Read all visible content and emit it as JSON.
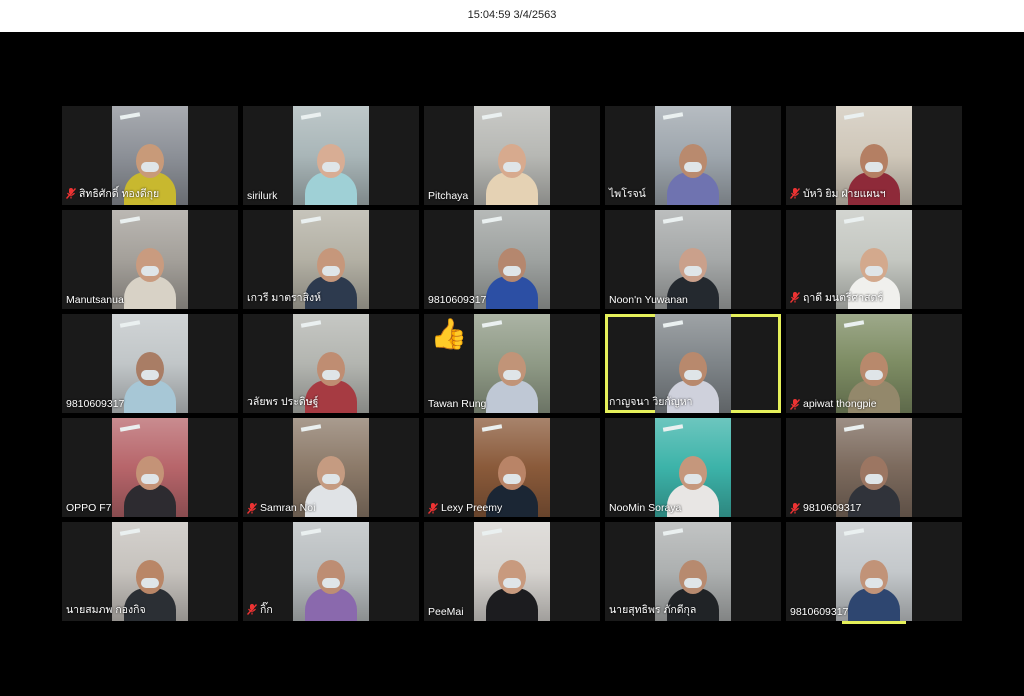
{
  "titlebar": {
    "clock": "15:04:59 3/4/2563"
  },
  "tiles": [
    {
      "name": "สิทธิศักดิ์ ทองดีกุย",
      "muted": true,
      "bg": "#8c9097",
      "face": "#c89a79",
      "shirt": "#c8b82f"
    },
    {
      "name": "sirilurk",
      "muted": false,
      "bg": "#a9b6b8",
      "face": "#d8ad94",
      "shirt": "#9fd0d6"
    },
    {
      "name": "Pitchaya",
      "muted": false,
      "bg": "#b7b8b4",
      "face": "#d7aa8e",
      "shirt": "#e5d2b4"
    },
    {
      "name": "ไพโรจน์",
      "muted": false,
      "bg": "#9ea6ad",
      "face": "#b98a6e",
      "shirt": "#6f73b0"
    },
    {
      "name": "บัหวิ ยิม ฝ่ายแผนฯ",
      "muted": true,
      "bg": "#cfc7b9",
      "face": "#b47f63",
      "shirt": "#8e2a39"
    },
    {
      "name": "Manutsanua",
      "muted": false,
      "bg": "#a4a09a",
      "face": "#c99b7f",
      "shirt": "#d8d2c6"
    },
    {
      "name": "เกวรี มาตราสิงห์",
      "muted": false,
      "bg": "#b3b0a4",
      "face": "#c6977b",
      "shirt": "#2d3a4e"
    },
    {
      "name": "9810609317",
      "muted": false,
      "bg": "#9ea2a0",
      "face": "#b5876e",
      "shirt": "#2c4fa4"
    },
    {
      "name": "Noon'n Yuwanan",
      "muted": false,
      "bg": "#a5a8a8",
      "face": "#caa08b",
      "shirt": "#24292f"
    },
    {
      "name": "ฤาดี มนตรีศาสตร์",
      "muted": true,
      "bg": "#c4c7c1",
      "face": "#d3a98d",
      "shirt": "#f0f0ed"
    },
    {
      "name": "9810609317",
      "muted": false,
      "bg": "#c1c6c8",
      "face": "#a97d65",
      "shirt": "#a7c7d6"
    },
    {
      "name": "วลัยพร ประดิษฐ์",
      "muted": false,
      "bg": "#b3b5b0",
      "face": "#bf8d72",
      "shirt": "#a63b42"
    },
    {
      "name": "Tawan Rung",
      "muted": false,
      "bg": "#8f9a86",
      "face": "#c19478",
      "shirt": "#bfc8d5",
      "thumb": "👍"
    },
    {
      "name": "กาญจนา วิยกัญหา",
      "muted": false,
      "bg": "#7e8488",
      "face": "#b8896d",
      "shirt": "#cfd1dc"
    },
    {
      "name": "apiwat thongpie",
      "muted": true,
      "bg": "#7d8c63",
      "face": "#b8896c",
      "shirt": "#93886b"
    },
    {
      "name": "OPPO F7",
      "muted": false,
      "bg": "#b7656a",
      "face": "#c49377",
      "shirt": "#2d2b30"
    },
    {
      "name": "Samran Noi",
      "muted": true,
      "bg": "#8c7a69",
      "face": "#c59b81",
      "shirt": "#e0e3e6"
    },
    {
      "name": "Lexy Preemy",
      "muted": true,
      "bg": "#8a5a3a",
      "face": "#b98467",
      "shirt": "#1b2634"
    },
    {
      "name": "NooMin Soraya",
      "muted": false,
      "bg": "#3cb3a9",
      "face": "#c5977c",
      "shirt": "#e8e6e4"
    },
    {
      "name": "9810609317",
      "muted": true,
      "bg": "#7c6a5d",
      "face": "#9c7662",
      "shirt": "#30333a"
    },
    {
      "name": "นายสมภพ กองกิจ",
      "muted": false,
      "bg": "#c6c2bd",
      "face": "#b98667",
      "shirt": "#2b2f34"
    },
    {
      "name": "กิ๊ก",
      "muted": true,
      "bg": "#b9bec0",
      "face": "#bd8d73",
      "shirt": "#8a69ad"
    },
    {
      "name": "PeeMai",
      "muted": false,
      "bg": "#d6d3cf",
      "face": "#c89a7e",
      "shirt": "#1c1c1f"
    },
    {
      "name": "นายสุทธิพร ภักดีกุล",
      "muted": false,
      "bg": "#adb0b0",
      "face": "#b78a6f",
      "shirt": "#202326"
    },
    {
      "name": "9810609317",
      "muted": false,
      "bg": "#c4c8cb",
      "face": "#c19378",
      "shirt": "#2e4670"
    }
  ],
  "active_tile": 13,
  "icons": {
    "muted": "mic-muted-icon",
    "thumb": "thumbs-up-icon"
  }
}
